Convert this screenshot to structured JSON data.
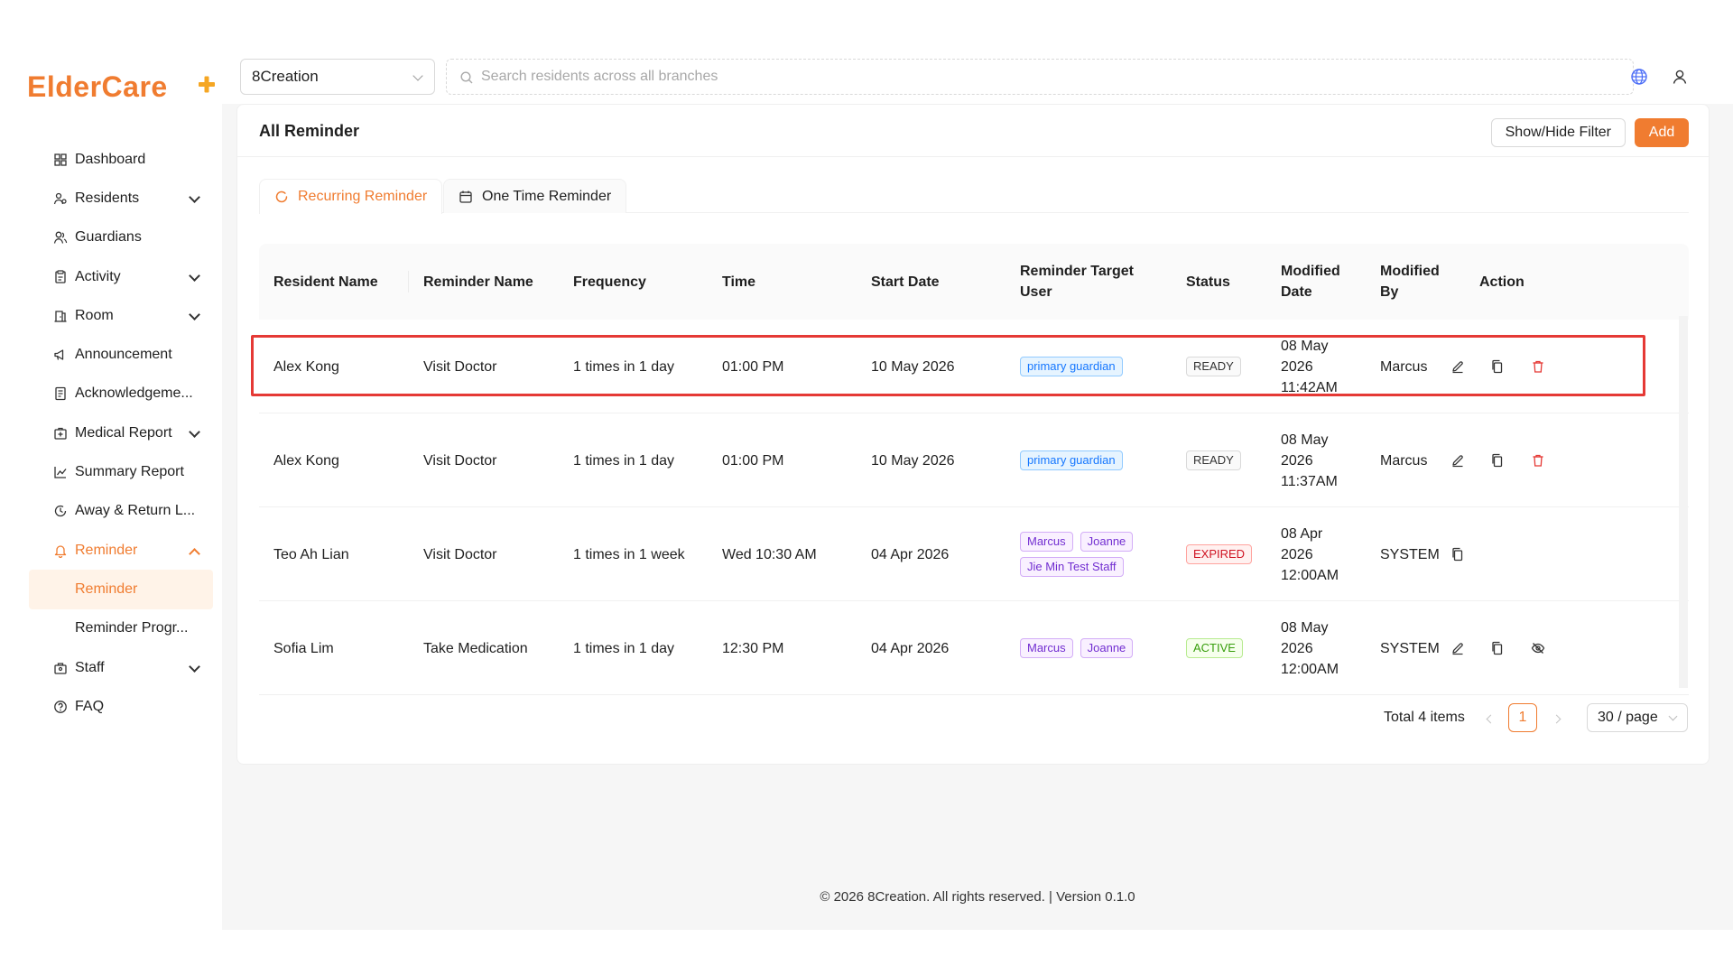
{
  "brand": {
    "logo_text": "ElderCare+",
    "accent": "#f07c30"
  },
  "sidebar": {
    "items": [
      {
        "label": "Dashboard",
        "icon": "dashboard-icon",
        "expandable": false
      },
      {
        "label": "Residents",
        "icon": "residents-icon",
        "expandable": true
      },
      {
        "label": "Guardians",
        "icon": "guardians-icon",
        "expandable": false
      },
      {
        "label": "Activity",
        "icon": "activity-icon",
        "expandable": true
      },
      {
        "label": "Room",
        "icon": "room-icon",
        "expandable": true
      },
      {
        "label": "Announcement",
        "icon": "announcement-icon",
        "expandable": false
      },
      {
        "label": "Acknowledgeme...",
        "icon": "acknowledgement-icon",
        "expandable": false
      },
      {
        "label": "Medical Report",
        "icon": "medical-report-icon",
        "expandable": true
      },
      {
        "label": "Summary Report",
        "icon": "summary-report-icon",
        "expandable": false
      },
      {
        "label": "Away & Return L...",
        "icon": "away-return-icon",
        "expandable": false
      },
      {
        "label": "Reminder",
        "icon": "bell-icon",
        "expandable": true,
        "open": true
      },
      {
        "label": "Staff",
        "icon": "staff-icon",
        "expandable": true
      },
      {
        "label": "FAQ",
        "icon": "faq-icon",
        "expandable": false
      }
    ],
    "reminder_sub": [
      {
        "label": "Reminder",
        "active": true
      },
      {
        "label": "Reminder Progr...",
        "active": false
      }
    ]
  },
  "topbar": {
    "branch": "8Creation",
    "search_placeholder": "Search residents across all branches"
  },
  "page": {
    "title": "All Reminder",
    "filter_button": "Show/Hide Filter",
    "add_button": "Add"
  },
  "tabs": [
    {
      "label": "Recurring Reminder",
      "active": true,
      "icon": "sync-icon"
    },
    {
      "label": "One Time Reminder",
      "active": false,
      "icon": "calendar-icon"
    }
  ],
  "table": {
    "columns": [
      "Resident Name",
      "Reminder Name",
      "Frequency",
      "Time",
      "Start Date",
      "Reminder Target User",
      "Status",
      "Modified Date",
      "Modified By",
      "Action"
    ],
    "rows": [
      {
        "resident": "Alex Kong",
        "reminder": "Visit Doctor",
        "frequency": "1 times in 1 day",
        "time": "01:00 PM",
        "start_date": "10 May 2026",
        "targets": [
          {
            "label": "primary guardian",
            "color": "blue"
          }
        ],
        "status": "READY",
        "status_kind": "ready",
        "modified_date": "08 May 2026 11:42AM",
        "modified_by": "Marcus",
        "actions": [
          "edit",
          "copy",
          "delete"
        ]
      },
      {
        "resident": "Alex Kong",
        "reminder": "Visit Doctor",
        "frequency": "1 times in 1 day",
        "time": "01:00 PM",
        "start_date": "10 May 2026",
        "targets": [
          {
            "label": "primary guardian",
            "color": "blue"
          }
        ],
        "status": "READY",
        "status_kind": "ready",
        "modified_date": "08 May 2026 11:37AM",
        "modified_by": "Marcus",
        "actions": [
          "edit",
          "copy",
          "delete"
        ]
      },
      {
        "resident": "Teo Ah Lian",
        "reminder": "Visit Doctor",
        "frequency": "1 times in 1 week",
        "time": "Wed 10:30 AM",
        "start_date": "04 Apr 2026",
        "targets": [
          {
            "label": "Marcus",
            "color": "purple"
          },
          {
            "label": "Joanne",
            "color": "purple"
          },
          {
            "label": "Jie Min Test Staff",
            "color": "purple"
          }
        ],
        "status": "EXPIRED",
        "status_kind": "expired",
        "modified_date": "08 Apr 2026 12:00AM",
        "modified_by": "SYSTEM",
        "actions": [
          "copy"
        ]
      },
      {
        "resident": "Sofia Lim",
        "reminder": "Take Medication",
        "frequency": "1 times in 1 day",
        "time": "12:30 PM",
        "start_date": "04 Apr 2026",
        "targets": [
          {
            "label": "Marcus",
            "color": "purple"
          },
          {
            "label": "Joanne",
            "color": "purple"
          }
        ],
        "status": "ACTIVE",
        "status_kind": "active",
        "modified_date": "08 May 2026 12:00AM",
        "modified_by": "SYSTEM",
        "actions": [
          "edit",
          "copy",
          "disable"
        ]
      }
    ]
  },
  "pagination": {
    "total": "Total 4 items",
    "current": "1",
    "page_size": "30 / page"
  },
  "footer": "© 2026 8Creation. All rights reserved. | Version 0.1.0"
}
